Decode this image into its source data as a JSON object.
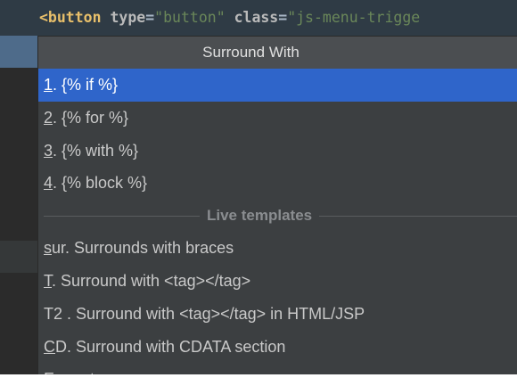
{
  "editor": {
    "code": {
      "open_tag": "<button",
      "attr1": " type",
      "eq1": "=",
      "val1": "\"button\"",
      "attr2": " class",
      "eq2": "=",
      "val2": "\"js-menu-trigge"
    }
  },
  "popup": {
    "title": "Surround With",
    "numbered_items": [
      {
        "mnemonic": "1",
        "rest": ". {% if %}",
        "selected": true
      },
      {
        "mnemonic": "2",
        "rest": ". {% for %}",
        "selected": false
      },
      {
        "mnemonic": "3",
        "rest": ". {% with %}",
        "selected": false
      },
      {
        "mnemonic": "4",
        "rest": ". {% block %}",
        "selected": false
      }
    ],
    "section_label": "Live templates",
    "template_items": [
      {
        "mnemonic": "s",
        "rest": "ur. Surrounds with braces"
      },
      {
        "mnemonic": "T",
        "rest": ". Surround with <tag></tag>"
      },
      {
        "mnemonic": "",
        "rest": "T2 . Surround with <tag></tag> in HTML/JSP"
      },
      {
        "mnemonic": "C",
        "rest": "D. Surround with CDATA section"
      },
      {
        "mnemonic": "E",
        "rest": "mmet"
      }
    ]
  },
  "colors": {
    "selection": "#2f65ca",
    "popup_bg": "#3c3f41",
    "title_bg": "#4b4e51",
    "editor_bg": "#2b2b2b"
  }
}
